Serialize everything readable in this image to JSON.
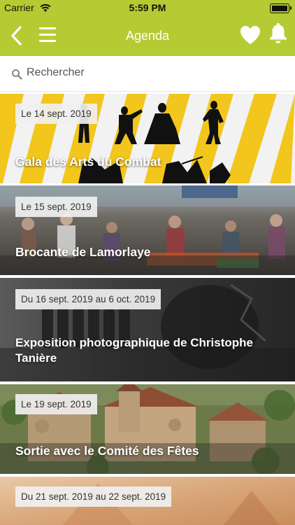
{
  "status_bar": {
    "carrier": "Carrier",
    "time": "5:59 PM"
  },
  "nav": {
    "title": "Agenda",
    "icons": [
      "chevron-left-icon",
      "hamburger-menu-icon",
      "heart-icon",
      "bell-icon"
    ]
  },
  "search": {
    "placeholder": "Rechercher",
    "value": ""
  },
  "events": [
    {
      "date": "Le 14 sept. 2019",
      "title": "Gala des Arts du Combat"
    },
    {
      "date": "Le 15 sept. 2019",
      "title": "Brocante de Lamorlaye"
    },
    {
      "date": "Du 16 sept. 2019 au 6 oct. 2019",
      "title": "Exposition photographique de Christophe Tanière"
    },
    {
      "date": "Le 19 sept. 2019",
      "title": "Sortie avec le Comité des Fêtes"
    },
    {
      "date": "Du 21 sept. 2019 au 22 sept. 2019",
      "title": ""
    }
  ],
  "colors": {
    "header": "#b5cb33",
    "header_text": "#ffffff",
    "date_badge_bg": "#f0f0f0",
    "event_title": "#ffffff"
  }
}
